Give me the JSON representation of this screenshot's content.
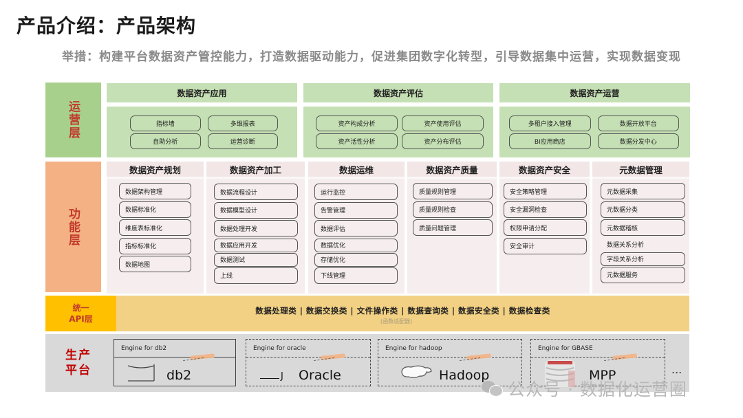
{
  "header": {
    "title": "产品介绍：产品架构",
    "subtitle": "举措：构建平台数据资产管控能力，打造数据驱动能力，促进集团数字化转型，引导数据集中运营，实现数据变现"
  },
  "colors": {
    "ops_label_bg": "#a8d08d",
    "ops_panel_bg": "#c5e0b4",
    "func_label_bg": "#f4b183",
    "func_panel_bg": "#f6eeee",
    "api_label_bg": "#ffc000",
    "api_bar_bg": "#f2d184",
    "prod_bg": "#d9d9d9",
    "label_text": "#c0392b"
  },
  "ops_layer": {
    "label": "运营层",
    "columns": [
      {
        "title": "数据资产应用",
        "items": [
          "指标墙",
          "多维报表",
          "自助分析",
          "运营诊断"
        ]
      },
      {
        "title": "数据资产评估",
        "items": [
          "资产构成分析",
          "资产使用评估",
          "资产活性分析",
          "资产分布评估"
        ]
      },
      {
        "title": "数据资产运营",
        "items": [
          "多租户接入管理",
          "数据开放平台",
          "BI应用商店",
          "数据分发中心"
        ]
      }
    ]
  },
  "func_layer": {
    "label": "功能层",
    "columns": [
      {
        "title": "数据资产规划",
        "items": [
          "数据架构管理",
          "数据标准化",
          "维度表标准化",
          "指标标准化",
          "数据地图"
        ]
      },
      {
        "title": "数据资产加工",
        "items": [
          "数据流程设计",
          "数据模型设计",
          "数据处理开发",
          "数据应用开发",
          "数据测试",
          "上线"
        ]
      },
      {
        "title": "数据运维",
        "items": [
          "运行监控",
          "告警管理",
          "数据评估",
          "数据优化",
          "存储优化",
          "下线管理"
        ]
      },
      {
        "title": "数据资产质量",
        "items": [
          "质量规则管理",
          "质量规则检查",
          "质量问题管理"
        ]
      },
      {
        "title": "数据资产安全",
        "items": [
          "安全策略管理",
          "安全漏洞检查",
          "权限申请分配",
          "安全审计"
        ]
      },
      {
        "title": "元数据管理",
        "items": [
          "元数据采集",
          "元数据分类",
          "元数据稽核",
          "数据关系分析",
          "字段关系分析",
          "元数据服务"
        ]
      }
    ]
  },
  "api_layer": {
    "label_line1": "统一",
    "label_line2": "API层",
    "categories": "数据处理类 | 数据交换类 | 文件操作类 | 数据查询类 | 数据安全类 | 数据检查类",
    "note": "(函数适配器)"
  },
  "prod_layer": {
    "label_line1": "生产",
    "label_line2": "平台",
    "engines": [
      {
        "title": "Engine for db2",
        "name": "db2",
        "icon": "database-icon"
      },
      {
        "title": "Engine for oracle",
        "name": "Oracle",
        "icon": "oracle-logo-icon"
      },
      {
        "title": "Engine for hadoop",
        "name": "Hadoop",
        "icon": "hadoop-elephant-icon"
      },
      {
        "title": "Engine for GBASE",
        "name": "MPP",
        "icon": "gbase-db-icon"
      }
    ],
    "more": "..."
  },
  "watermark": "公众号 · 数据化运营圈"
}
